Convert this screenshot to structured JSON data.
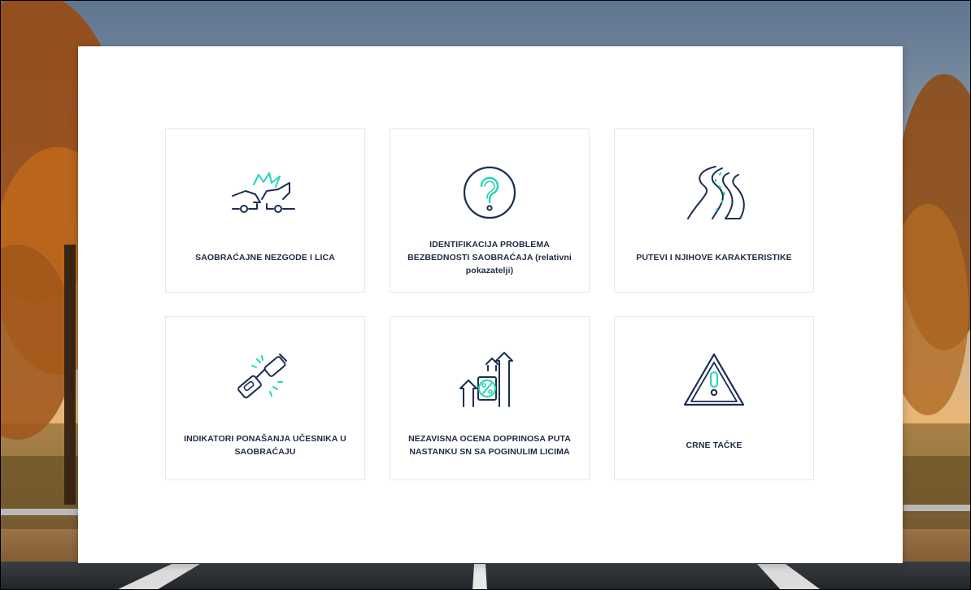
{
  "colors": {
    "navy": "#1b2d52",
    "accent": "#1fd6b4",
    "card_border": "#e4e8ec",
    "label": "#1e2a44"
  },
  "cards": [
    {
      "label": "SAOBRAĆAJNE NEZGODE I LICA",
      "icon": "car-crash-icon"
    },
    {
      "label": "IDENTIFIKACIJA PROBLEMA BEZBEDNOSTI SAOBRAĆAJA (relativni pokazatelji)",
      "icon": "question-icon"
    },
    {
      "label": "PUTEVI I NJIHOVE KARAKTERISTIKE",
      "icon": "winding-road-icon"
    },
    {
      "label": "INDIKATORI PONAŠANJA UČESNIKA U SAOBRAĆAJU",
      "icon": "seatbelt-icon"
    },
    {
      "label": "NEZAVISNA OCENA DOPRINOSA PUTA NASTANKU SN SA POGINULIM LICIMA",
      "icon": "growth-percent-icon"
    },
    {
      "label": "CRNE TAČKE",
      "icon": "warning-triangle-icon"
    }
  ]
}
